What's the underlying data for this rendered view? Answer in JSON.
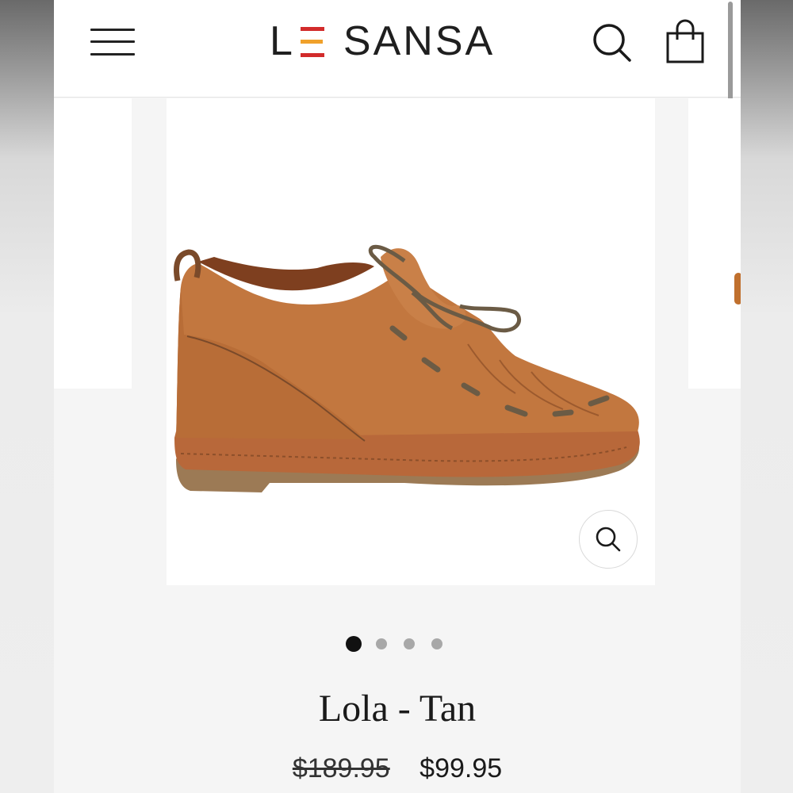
{
  "header": {
    "logo": {
      "letter": "L",
      "name": "SANSA",
      "e_colors": [
        "#d22b2b",
        "#f0a12b",
        "#d22b2b"
      ]
    },
    "menu_icon": "hamburger-icon",
    "search_icon": "search-icon",
    "cart_icon": "shopping-bag-icon"
  },
  "gallery": {
    "image_alt": "tan leather lace-up ankle shoe",
    "zoom_icon": "zoom-icon",
    "slides": 4,
    "active_slide": 1
  },
  "product": {
    "title": "Lola - Tan",
    "price_old": "$189.95",
    "price_new": "$99.95"
  },
  "colors": {
    "leather": "#c2773f",
    "sole": "#9c7a55",
    "lace": "#6b5b45"
  }
}
